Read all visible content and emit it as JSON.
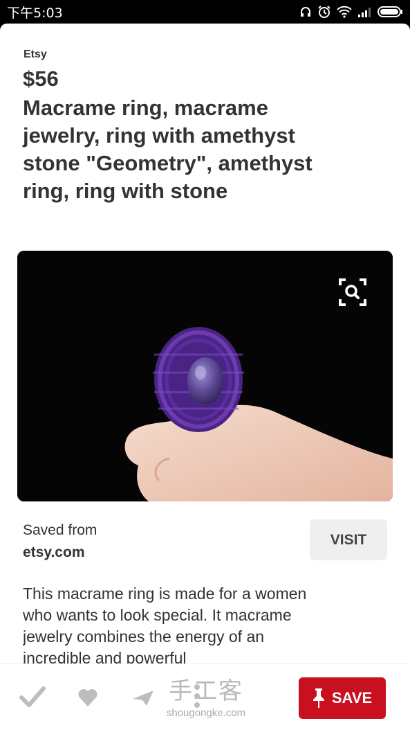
{
  "status_bar": {
    "time": "下午5:03",
    "icons": [
      "headphones-icon",
      "alarm-icon",
      "wifi-icon",
      "signal-icon",
      "battery-icon"
    ]
  },
  "pin": {
    "source": "Etsy",
    "price": "$56",
    "title": "Macrame ring, macrame jewelry, ring with amethyst stone \"Geometry\", amethyst ring, ring with stone",
    "image_description": "purple macrame ring with amethyst stone held by fingertip on black background"
  },
  "saved": {
    "label": "Saved from",
    "domain": "etsy.com",
    "visit_label": "VISIT"
  },
  "description": "This macrame ring is made for a women who wants to look special. It macrame jewelry combines the energy of an incredible and powerful",
  "actions": {
    "icons": [
      "checkmark-icon",
      "heart-icon",
      "send-icon",
      "more-icon"
    ],
    "save_label": "SAVE"
  },
  "watermark": {
    "logo": "手工客",
    "domain": "shougongke.com"
  },
  "colors": {
    "save_red": "#c8101f",
    "text_dark": "#333333",
    "visit_bg": "#efefef"
  }
}
